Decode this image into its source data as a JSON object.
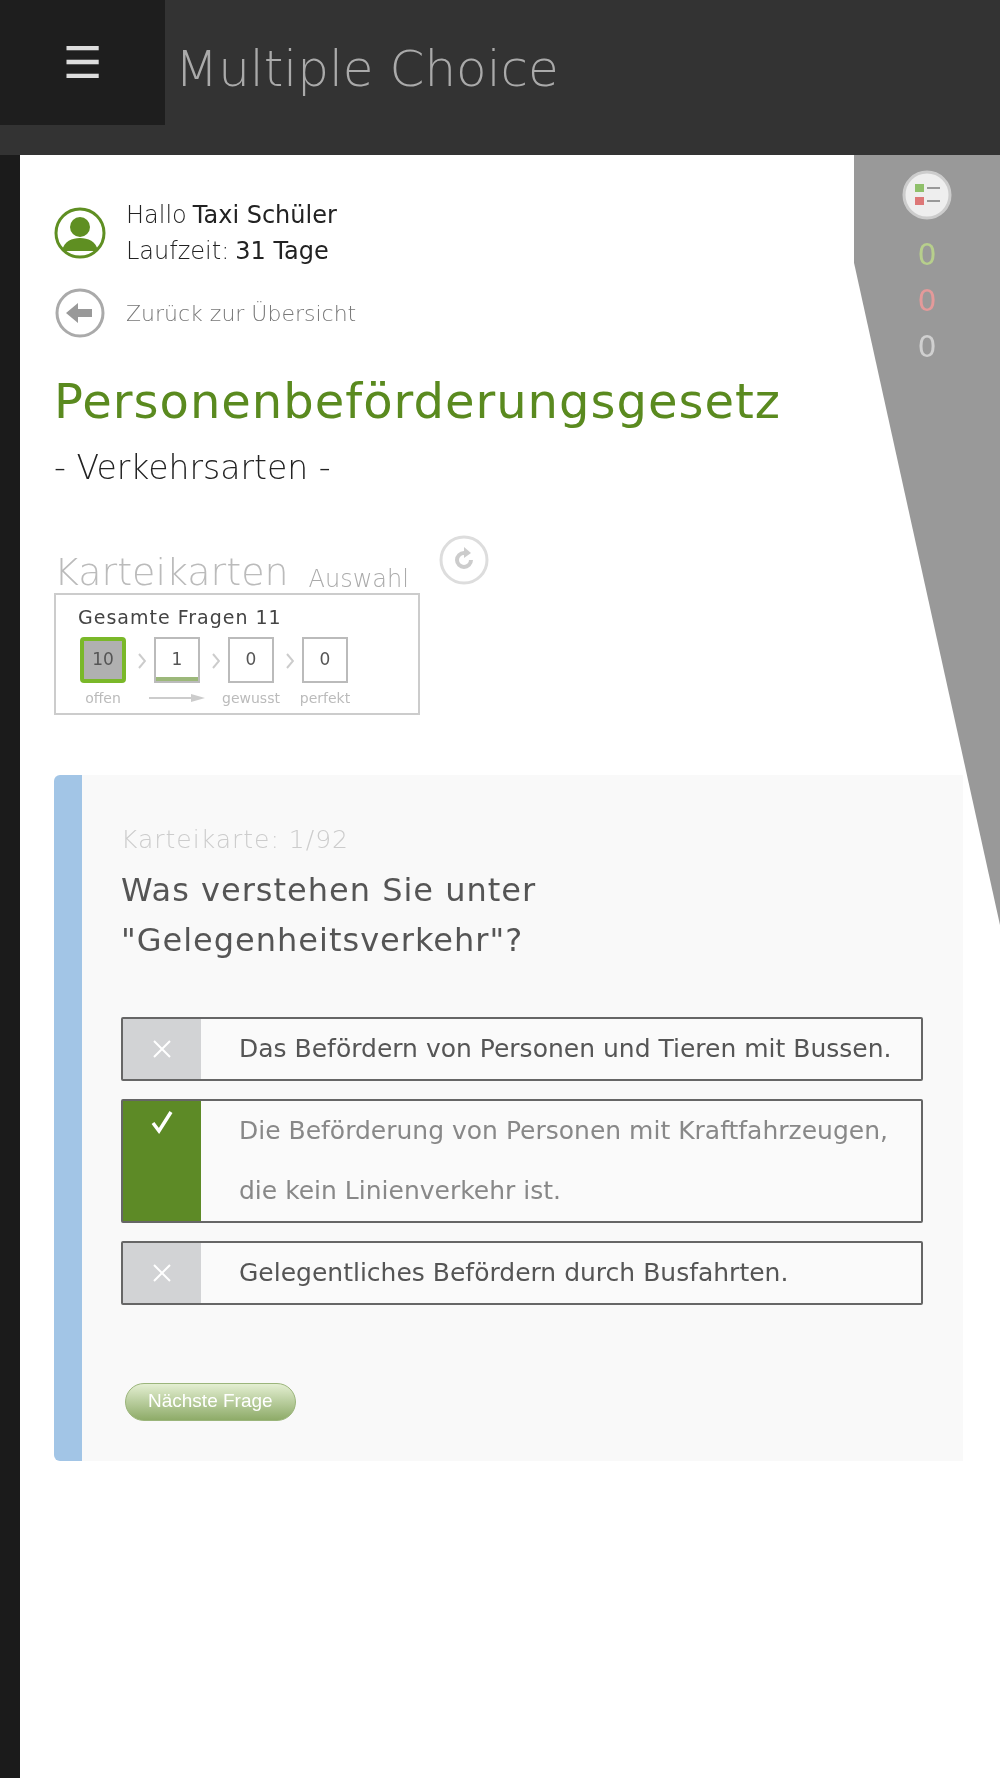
{
  "header": {
    "menu_icon": "☰",
    "title": "Multiple Choice"
  },
  "user": {
    "greeting": "Hallo",
    "name": "Taxi Schüler",
    "runtime_label": "Laufzeit:",
    "runtime": "31 Tage"
  },
  "back_link": "Zurück zur Übersicht",
  "side_counts": [
    {
      "value": "0",
      "color": "#b7cf8c"
    },
    {
      "value": "0",
      "color": "#e49a9a"
    },
    {
      "value": "0",
      "color": "#d0d0d0"
    }
  ],
  "topic": {
    "title": "Personenbeförderungsgesetz",
    "subtitle": "- Verkehrsarten -"
  },
  "flashcards": {
    "title": "Karteikarten",
    "subtitle": "Auswahl",
    "total": "Gesamte Fragen 11",
    "stages": [
      {
        "count": "10",
        "label": "offen",
        "selected": true,
        "level": 0
      },
      {
        "count": "1",
        "selected": false,
        "level": 1
      },
      {
        "count": "0",
        "label": "gewusst",
        "selected": false,
        "level": 0
      },
      {
        "count": "0",
        "label": "perfekt",
        "selected": false,
        "level": 0
      }
    ]
  },
  "question": {
    "counter": "Karteikarte: 1/92",
    "text": "Was verstehen Sie unter \"Gelegenheitsverkehr\"?",
    "answers": [
      {
        "text": "Das Befördern von Personen und Tieren mit Bussen.",
        "correct": false
      },
      {
        "text": "Die Beförderung von Personen mit Kraftfahrzeugen, die kein Linienverkehr ist.",
        "correct": true
      },
      {
        "text": "Gelegentliches Befördern durch Busfahrten.",
        "correct": false
      }
    ],
    "next_button": "Nächste Frage"
  }
}
